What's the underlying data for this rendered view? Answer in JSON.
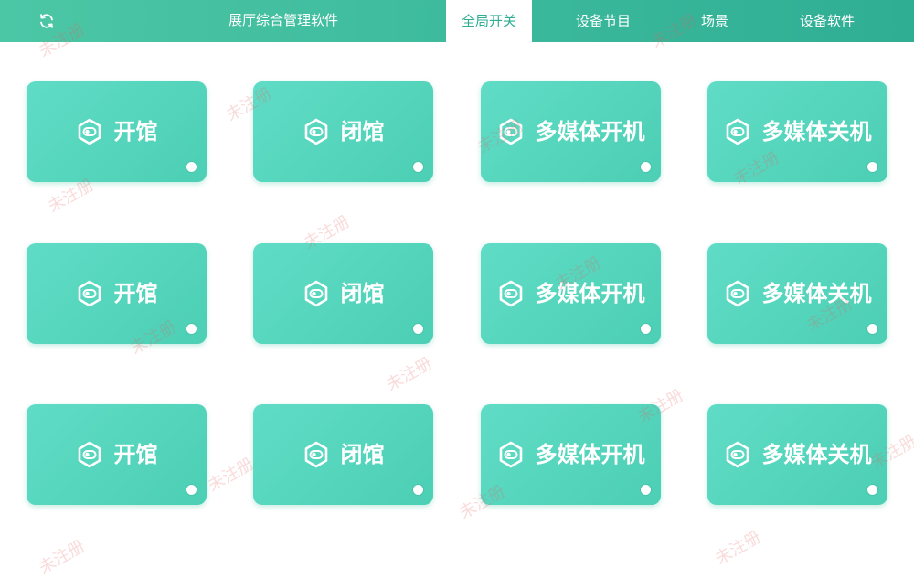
{
  "header": {
    "title": "展厅综合管理软件",
    "refresh_icon": "refresh-icon",
    "tabs": [
      {
        "label": "全局开关",
        "active": true
      },
      {
        "label": "设备节目",
        "active": false
      },
      {
        "label": "场景",
        "active": false
      },
      {
        "label": "设备软件",
        "active": false
      }
    ]
  },
  "colors": {
    "header_start": "#4cc7a6",
    "header_end": "#2fae94",
    "card": "#56d6bd",
    "watermark": "#e65a5a"
  },
  "card_icon": "toggle-hexagon-icon",
  "cards": [
    {
      "label": "开馆"
    },
    {
      "label": "闭馆"
    },
    {
      "label": "多媒体开机"
    },
    {
      "label": "多媒体关机"
    },
    {
      "label": "开馆"
    },
    {
      "label": "闭馆"
    },
    {
      "label": "多媒体开机"
    },
    {
      "label": "多媒体关机"
    },
    {
      "label": "开馆"
    },
    {
      "label": "闭馆"
    },
    {
      "label": "多媒体开机"
    },
    {
      "label": "多媒体关机"
    }
  ],
  "watermark_text": "未注册"
}
